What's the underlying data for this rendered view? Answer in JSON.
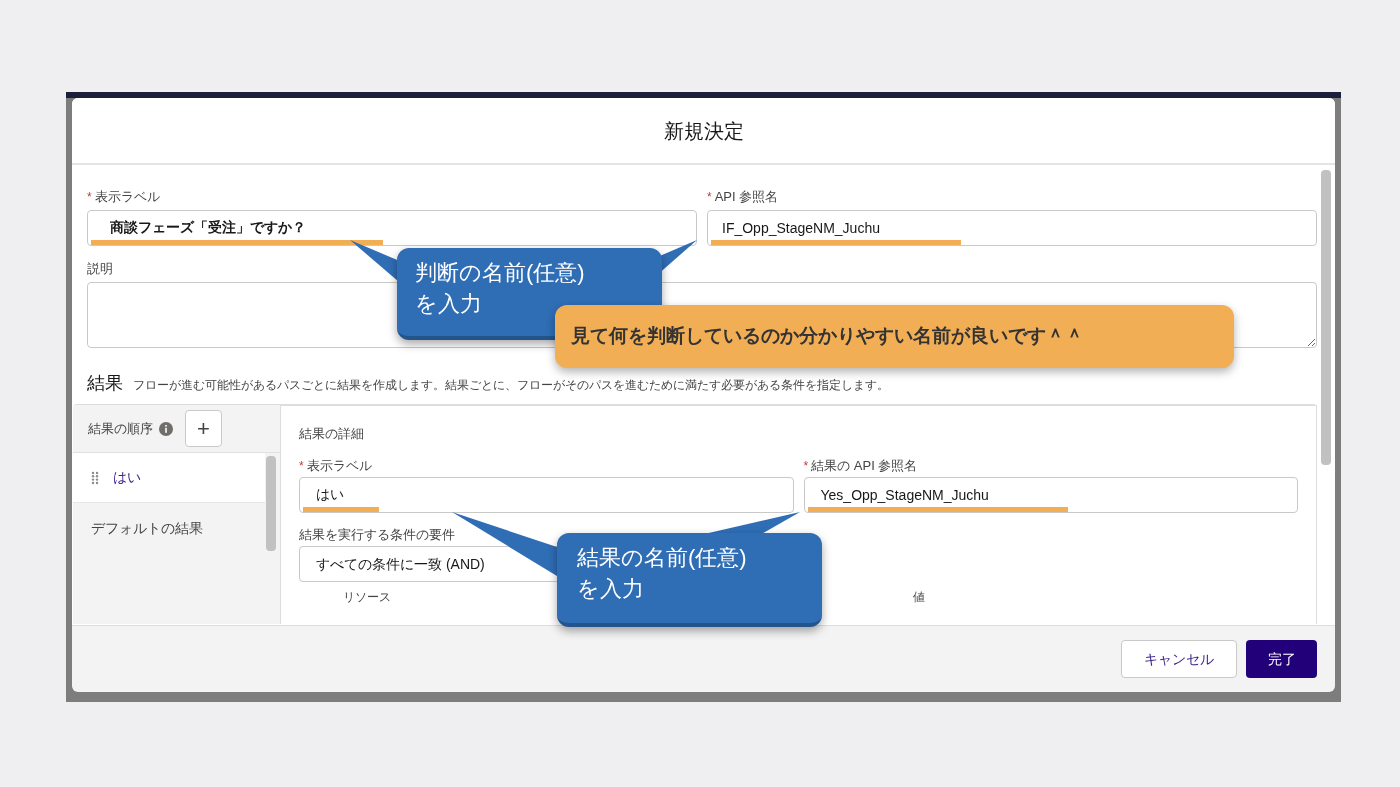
{
  "modal": {
    "title": "新規決定"
  },
  "fields": [
    {
      "label": "表示ラベル",
      "required_mark": "*",
      "value": "商談フェーズ「受注」ですか？",
      "bold": true,
      "highlighted": true
    },
    {
      "label": "API 参照名",
      "required_mark": "*",
      "value": "IF_Opp_StageNM_Juchu",
      "bold": false,
      "highlighted": true
    }
  ],
  "description": {
    "label": "説明"
  },
  "outcomes": {
    "title": "結果",
    "description": "フローが進む可能性があるパスごとに結果を作成します。結果ごとに、フローがそのパスを進むために満たす必要がある条件を指定します。"
  },
  "outcome_order": {
    "label": "結果の順序",
    "add_button": "+",
    "items": [
      {
        "label": "はい",
        "selected": true
      },
      {
        "label": "デフォルトの結果",
        "selected": false
      }
    ]
  },
  "outcome_details": {
    "title": "結果の詳細",
    "fields": [
      {
        "label": "表示ラベル",
        "required_mark": "*",
        "value": "はい",
        "highlighted": true
      },
      {
        "label": "結果の API 参照名",
        "required_mark": "*",
        "value": "Yes_Opp_StageNM_Juchu",
        "highlighted": true
      }
    ],
    "condition": {
      "label": "結果を実行する条件の要件",
      "value": "すべての条件に一致 (AND)"
    },
    "columns": [
      "リソース",
      "値"
    ]
  },
  "buttons": [
    {
      "label": "キャンセル",
      "kind": "neutral"
    },
    {
      "label": "完了",
      "kind": "brand"
    }
  ],
  "annotations": [
    {
      "kind": "blue",
      "text": "判断の名前(任意)\nを入力"
    },
    {
      "kind": "orange",
      "text": "見て何を判断しているのか分かりやすい名前が良いです＾＾"
    },
    {
      "kind": "blue",
      "text": "結果の名前(任意)\nを入力"
    }
  ]
}
